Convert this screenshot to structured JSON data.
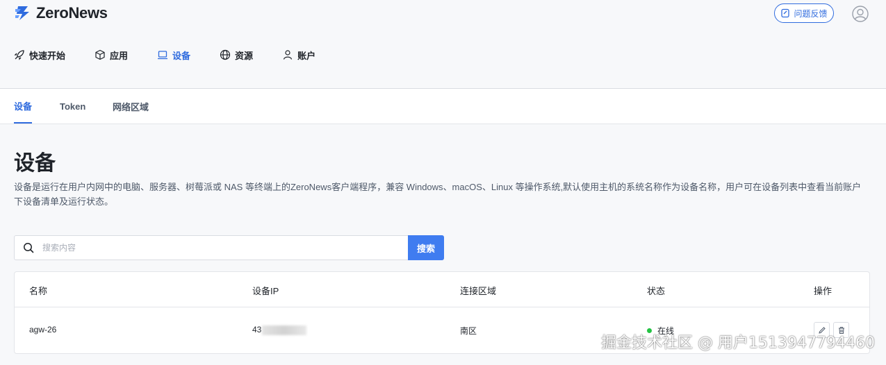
{
  "brand": {
    "name": "ZeroNews",
    "color": "#2f6bde"
  },
  "header": {
    "feedback_label": "问题反馈",
    "feedback_icon": "feedback-icon",
    "avatar_icon": "user-circle-icon"
  },
  "nav": [
    {
      "label": "快速开始",
      "icon": "rocket-icon"
    },
    {
      "label": "应用",
      "icon": "box-icon"
    },
    {
      "label": "设备",
      "icon": "laptop-icon",
      "active": true
    },
    {
      "label": "资源",
      "icon": "globe-icon"
    },
    {
      "label": "账户",
      "icon": "user-icon"
    }
  ],
  "subnav": [
    {
      "label": "设备",
      "active": true
    },
    {
      "label": "Token"
    },
    {
      "label": "网络区域"
    }
  ],
  "page": {
    "title": "设备",
    "description": "设备是运行在用户内网中的电脑、服务器、树莓派或 NAS 等终端上的ZeroNews客户端程序，兼容 Windows、macOS、Linux 等操作系统,默认使用主机的系统名称作为设备名称，用户可在设备列表中查看当前账户下设备清单及运行状态。"
  },
  "search": {
    "placeholder": "搜索内容",
    "value": "",
    "button_label": "搜索"
  },
  "table": {
    "columns": [
      "名称",
      "设备IP",
      "连接区域",
      "状态",
      "操作"
    ],
    "rows": [
      {
        "name": "agw-26",
        "ip_prefix": "43",
        "region": "南区",
        "status": "在线",
        "status_color": "#23c343"
      }
    ]
  },
  "watermark": "掘金技术社区 @ 用户1513947794460"
}
